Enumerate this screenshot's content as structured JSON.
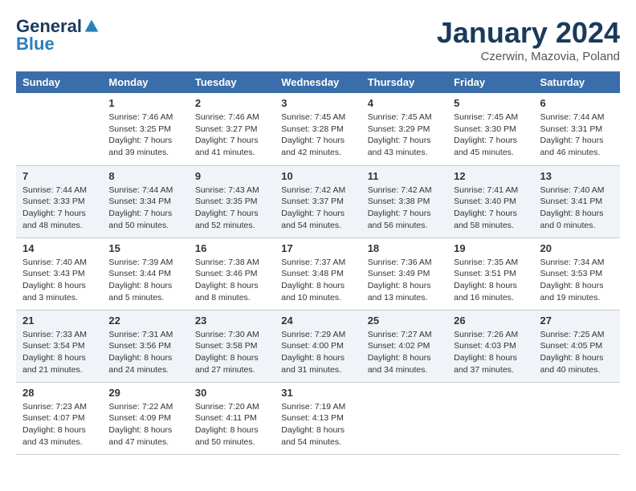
{
  "logo": {
    "general": "General",
    "blue": "Blue"
  },
  "title": "January 2024",
  "location": "Czerwin, Mazovia, Poland",
  "days_of_week": [
    "Sunday",
    "Monday",
    "Tuesday",
    "Wednesday",
    "Thursday",
    "Friday",
    "Saturday"
  ],
  "weeks": [
    [
      {
        "day": "",
        "info": ""
      },
      {
        "day": "1",
        "info": "Sunrise: 7:46 AM\nSunset: 3:25 PM\nDaylight: 7 hours\nand 39 minutes."
      },
      {
        "day": "2",
        "info": "Sunrise: 7:46 AM\nSunset: 3:27 PM\nDaylight: 7 hours\nand 41 minutes."
      },
      {
        "day": "3",
        "info": "Sunrise: 7:45 AM\nSunset: 3:28 PM\nDaylight: 7 hours\nand 42 minutes."
      },
      {
        "day": "4",
        "info": "Sunrise: 7:45 AM\nSunset: 3:29 PM\nDaylight: 7 hours\nand 43 minutes."
      },
      {
        "day": "5",
        "info": "Sunrise: 7:45 AM\nSunset: 3:30 PM\nDaylight: 7 hours\nand 45 minutes."
      },
      {
        "day": "6",
        "info": "Sunrise: 7:44 AM\nSunset: 3:31 PM\nDaylight: 7 hours\nand 46 minutes."
      }
    ],
    [
      {
        "day": "7",
        "info": "Sunrise: 7:44 AM\nSunset: 3:33 PM\nDaylight: 7 hours\nand 48 minutes."
      },
      {
        "day": "8",
        "info": "Sunrise: 7:44 AM\nSunset: 3:34 PM\nDaylight: 7 hours\nand 50 minutes."
      },
      {
        "day": "9",
        "info": "Sunrise: 7:43 AM\nSunset: 3:35 PM\nDaylight: 7 hours\nand 52 minutes."
      },
      {
        "day": "10",
        "info": "Sunrise: 7:42 AM\nSunset: 3:37 PM\nDaylight: 7 hours\nand 54 minutes."
      },
      {
        "day": "11",
        "info": "Sunrise: 7:42 AM\nSunset: 3:38 PM\nDaylight: 7 hours\nand 56 minutes."
      },
      {
        "day": "12",
        "info": "Sunrise: 7:41 AM\nSunset: 3:40 PM\nDaylight: 7 hours\nand 58 minutes."
      },
      {
        "day": "13",
        "info": "Sunrise: 7:40 AM\nSunset: 3:41 PM\nDaylight: 8 hours\nand 0 minutes."
      }
    ],
    [
      {
        "day": "14",
        "info": "Sunrise: 7:40 AM\nSunset: 3:43 PM\nDaylight: 8 hours\nand 3 minutes."
      },
      {
        "day": "15",
        "info": "Sunrise: 7:39 AM\nSunset: 3:44 PM\nDaylight: 8 hours\nand 5 minutes."
      },
      {
        "day": "16",
        "info": "Sunrise: 7:38 AM\nSunset: 3:46 PM\nDaylight: 8 hours\nand 8 minutes."
      },
      {
        "day": "17",
        "info": "Sunrise: 7:37 AM\nSunset: 3:48 PM\nDaylight: 8 hours\nand 10 minutes."
      },
      {
        "day": "18",
        "info": "Sunrise: 7:36 AM\nSunset: 3:49 PM\nDaylight: 8 hours\nand 13 minutes."
      },
      {
        "day": "19",
        "info": "Sunrise: 7:35 AM\nSunset: 3:51 PM\nDaylight: 8 hours\nand 16 minutes."
      },
      {
        "day": "20",
        "info": "Sunrise: 7:34 AM\nSunset: 3:53 PM\nDaylight: 8 hours\nand 19 minutes."
      }
    ],
    [
      {
        "day": "21",
        "info": "Sunrise: 7:33 AM\nSunset: 3:54 PM\nDaylight: 8 hours\nand 21 minutes."
      },
      {
        "day": "22",
        "info": "Sunrise: 7:31 AM\nSunset: 3:56 PM\nDaylight: 8 hours\nand 24 minutes."
      },
      {
        "day": "23",
        "info": "Sunrise: 7:30 AM\nSunset: 3:58 PM\nDaylight: 8 hours\nand 27 minutes."
      },
      {
        "day": "24",
        "info": "Sunrise: 7:29 AM\nSunset: 4:00 PM\nDaylight: 8 hours\nand 31 minutes."
      },
      {
        "day": "25",
        "info": "Sunrise: 7:27 AM\nSunset: 4:02 PM\nDaylight: 8 hours\nand 34 minutes."
      },
      {
        "day": "26",
        "info": "Sunrise: 7:26 AM\nSunset: 4:03 PM\nDaylight: 8 hours\nand 37 minutes."
      },
      {
        "day": "27",
        "info": "Sunrise: 7:25 AM\nSunset: 4:05 PM\nDaylight: 8 hours\nand 40 minutes."
      }
    ],
    [
      {
        "day": "28",
        "info": "Sunrise: 7:23 AM\nSunset: 4:07 PM\nDaylight: 8 hours\nand 43 minutes."
      },
      {
        "day": "29",
        "info": "Sunrise: 7:22 AM\nSunset: 4:09 PM\nDaylight: 8 hours\nand 47 minutes."
      },
      {
        "day": "30",
        "info": "Sunrise: 7:20 AM\nSunset: 4:11 PM\nDaylight: 8 hours\nand 50 minutes."
      },
      {
        "day": "31",
        "info": "Sunrise: 7:19 AM\nSunset: 4:13 PM\nDaylight: 8 hours\nand 54 minutes."
      },
      {
        "day": "",
        "info": ""
      },
      {
        "day": "",
        "info": ""
      },
      {
        "day": "",
        "info": ""
      }
    ]
  ]
}
